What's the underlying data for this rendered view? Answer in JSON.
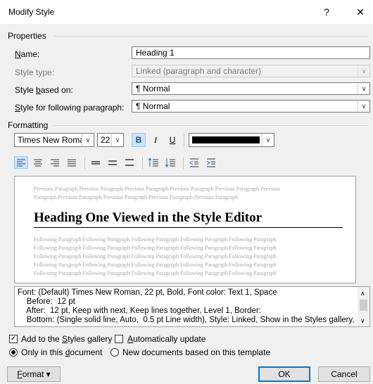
{
  "window": {
    "title": "Modify Style",
    "help_label": "?",
    "close_label": "✕"
  },
  "properties": {
    "group_label": "Properties",
    "name_label": "Name:",
    "name_value": "Heading 1",
    "style_type_label": "Style type:",
    "style_type_value": "Linked (paragraph and character)",
    "based_on_label": "Style based on:",
    "based_on_value": "¶  Normal",
    "following_label": "Style for following paragraph:",
    "following_value": "¶  Normal"
  },
  "formatting": {
    "group_label": "Formatting",
    "font": "Times New Roman",
    "size": "22",
    "bold": "B",
    "italic": "I",
    "underline": "U",
    "color": "#000000"
  },
  "preview": {
    "previous_lines": [
      "Previous Paragraph Previous Paragraph Previous Paragraph Previous Paragraph Previous Paragraph Previous",
      "Paragraph Previous Paragraph Previous Paragraph Previous Paragraph Previous Paragraph"
    ],
    "heading": "Heading One Viewed in the Style Editor",
    "following_lines": [
      "Following Paragraph Following Paragraph Following Paragraph Following Paragraph Following Paragraph",
      "Following Paragraph Following Paragraph Following Paragraph Following Paragraph Following Paragraph",
      "Following Paragraph Following Paragraph Following Paragraph Following Paragraph Following Paragraph",
      "Following Paragraph Following Paragraph Following Paragraph Following Paragraph Following Paragraph",
      "Following Paragraph Following Paragraph Following Paragraph Following Paragraph Following Paragraph"
    ]
  },
  "description": {
    "lines": [
      "Font: (Default) Times New Roman, 22 pt, Bold, Font color: Text 1, Space",
      "    Before:  12 pt",
      "    After:  12 pt, Keep with next, Keep lines together, Level 1, Border:",
      "    Bottom: (Single solid line, Auto,  0.5 pt Line width), Style: Linked, Show in the Styles gallery,"
    ]
  },
  "options": {
    "add_to_gallery": "Add to the Styles gallery",
    "add_to_gallery_checked": true,
    "auto_update": "Automatically update",
    "auto_update_checked": false,
    "only_this_doc": "Only in this document",
    "new_docs": "New documents based on this template",
    "selected_scope": "only_this_doc"
  },
  "buttons": {
    "format": "Format",
    "ok": "OK",
    "cancel": "Cancel"
  },
  "colors": {
    "accent": "#0078d7",
    "active_bg": "#cce4f7"
  }
}
